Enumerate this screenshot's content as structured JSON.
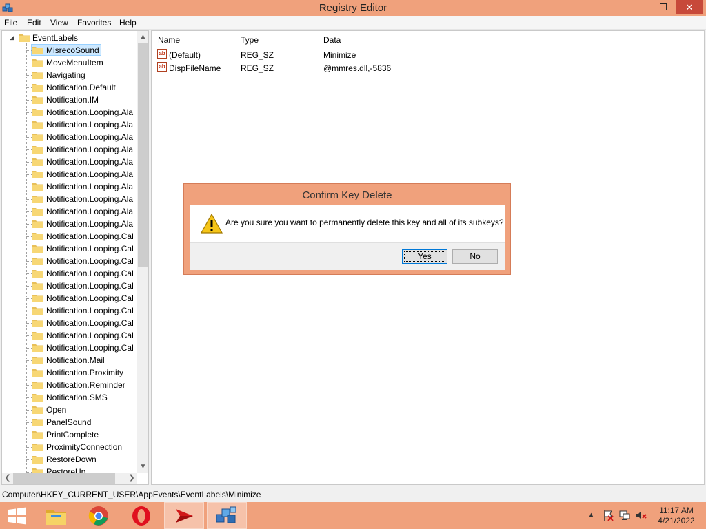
{
  "window": {
    "title": "Registry Editor",
    "icons": {
      "app": "registry-icon",
      "minimize": "minimize-icon",
      "maximize": "restore-icon",
      "close": "close-icon"
    }
  },
  "menu": [
    "File",
    "Edit",
    "View",
    "Favorites",
    "Help"
  ],
  "tree": {
    "parent": "EventLabels",
    "selected": "MisrecoSound",
    "items": [
      "MisrecoSound",
      "MoveMenuItem",
      "Navigating",
      "Notification.Default",
      "Notification.IM",
      "Notification.Looping.Ala",
      "Notification.Looping.Ala",
      "Notification.Looping.Ala",
      "Notification.Looping.Ala",
      "Notification.Looping.Ala",
      "Notification.Looping.Ala",
      "Notification.Looping.Ala",
      "Notification.Looping.Ala",
      "Notification.Looping.Ala",
      "Notification.Looping.Ala",
      "Notification.Looping.Cal",
      "Notification.Looping.Cal",
      "Notification.Looping.Cal",
      "Notification.Looping.Cal",
      "Notification.Looping.Cal",
      "Notification.Looping.Cal",
      "Notification.Looping.Cal",
      "Notification.Looping.Cal",
      "Notification.Looping.Cal",
      "Notification.Looping.Cal",
      "Notification.Mail",
      "Notification.Proximity",
      "Notification.Reminder",
      "Notification.SMS",
      "Open",
      "PanelSound",
      "PrintComplete",
      "ProximityConnection",
      "RestoreDown",
      "RestoreUp"
    ]
  },
  "list": {
    "columns": [
      "Name",
      "Type",
      "Data"
    ],
    "rows": [
      {
        "name": "(Default)",
        "type": "REG_SZ",
        "data": "Minimize"
      },
      {
        "name": "DispFileName",
        "type": "REG_SZ",
        "data": "@mmres.dll,-5836"
      }
    ]
  },
  "status": "Computer\\HKEY_CURRENT_USER\\AppEvents\\EventLabels\\Minimize",
  "dialog": {
    "title": "Confirm Key Delete",
    "message": "Are you sure you want to permanently delete this key and all of its subkeys?",
    "yes_label": "Yes",
    "no_label": "No",
    "icon": "warning-icon"
  },
  "taskbar": {
    "apps": [
      "windows-start-icon",
      "file-explorer-icon",
      "chrome-icon",
      "opera-icon",
      "red-arrow-app-icon",
      "registry-editor-icon"
    ],
    "tray": [
      "show-hidden-icons-icon",
      "action-center-flag-icon",
      "network-icon",
      "volume-muted-icon"
    ],
    "time": "11:17 AM",
    "date": "4/21/2022"
  },
  "colors": {
    "accent": "#f0a17c",
    "close": "#c7493a",
    "selection": "#cce8ff"
  }
}
